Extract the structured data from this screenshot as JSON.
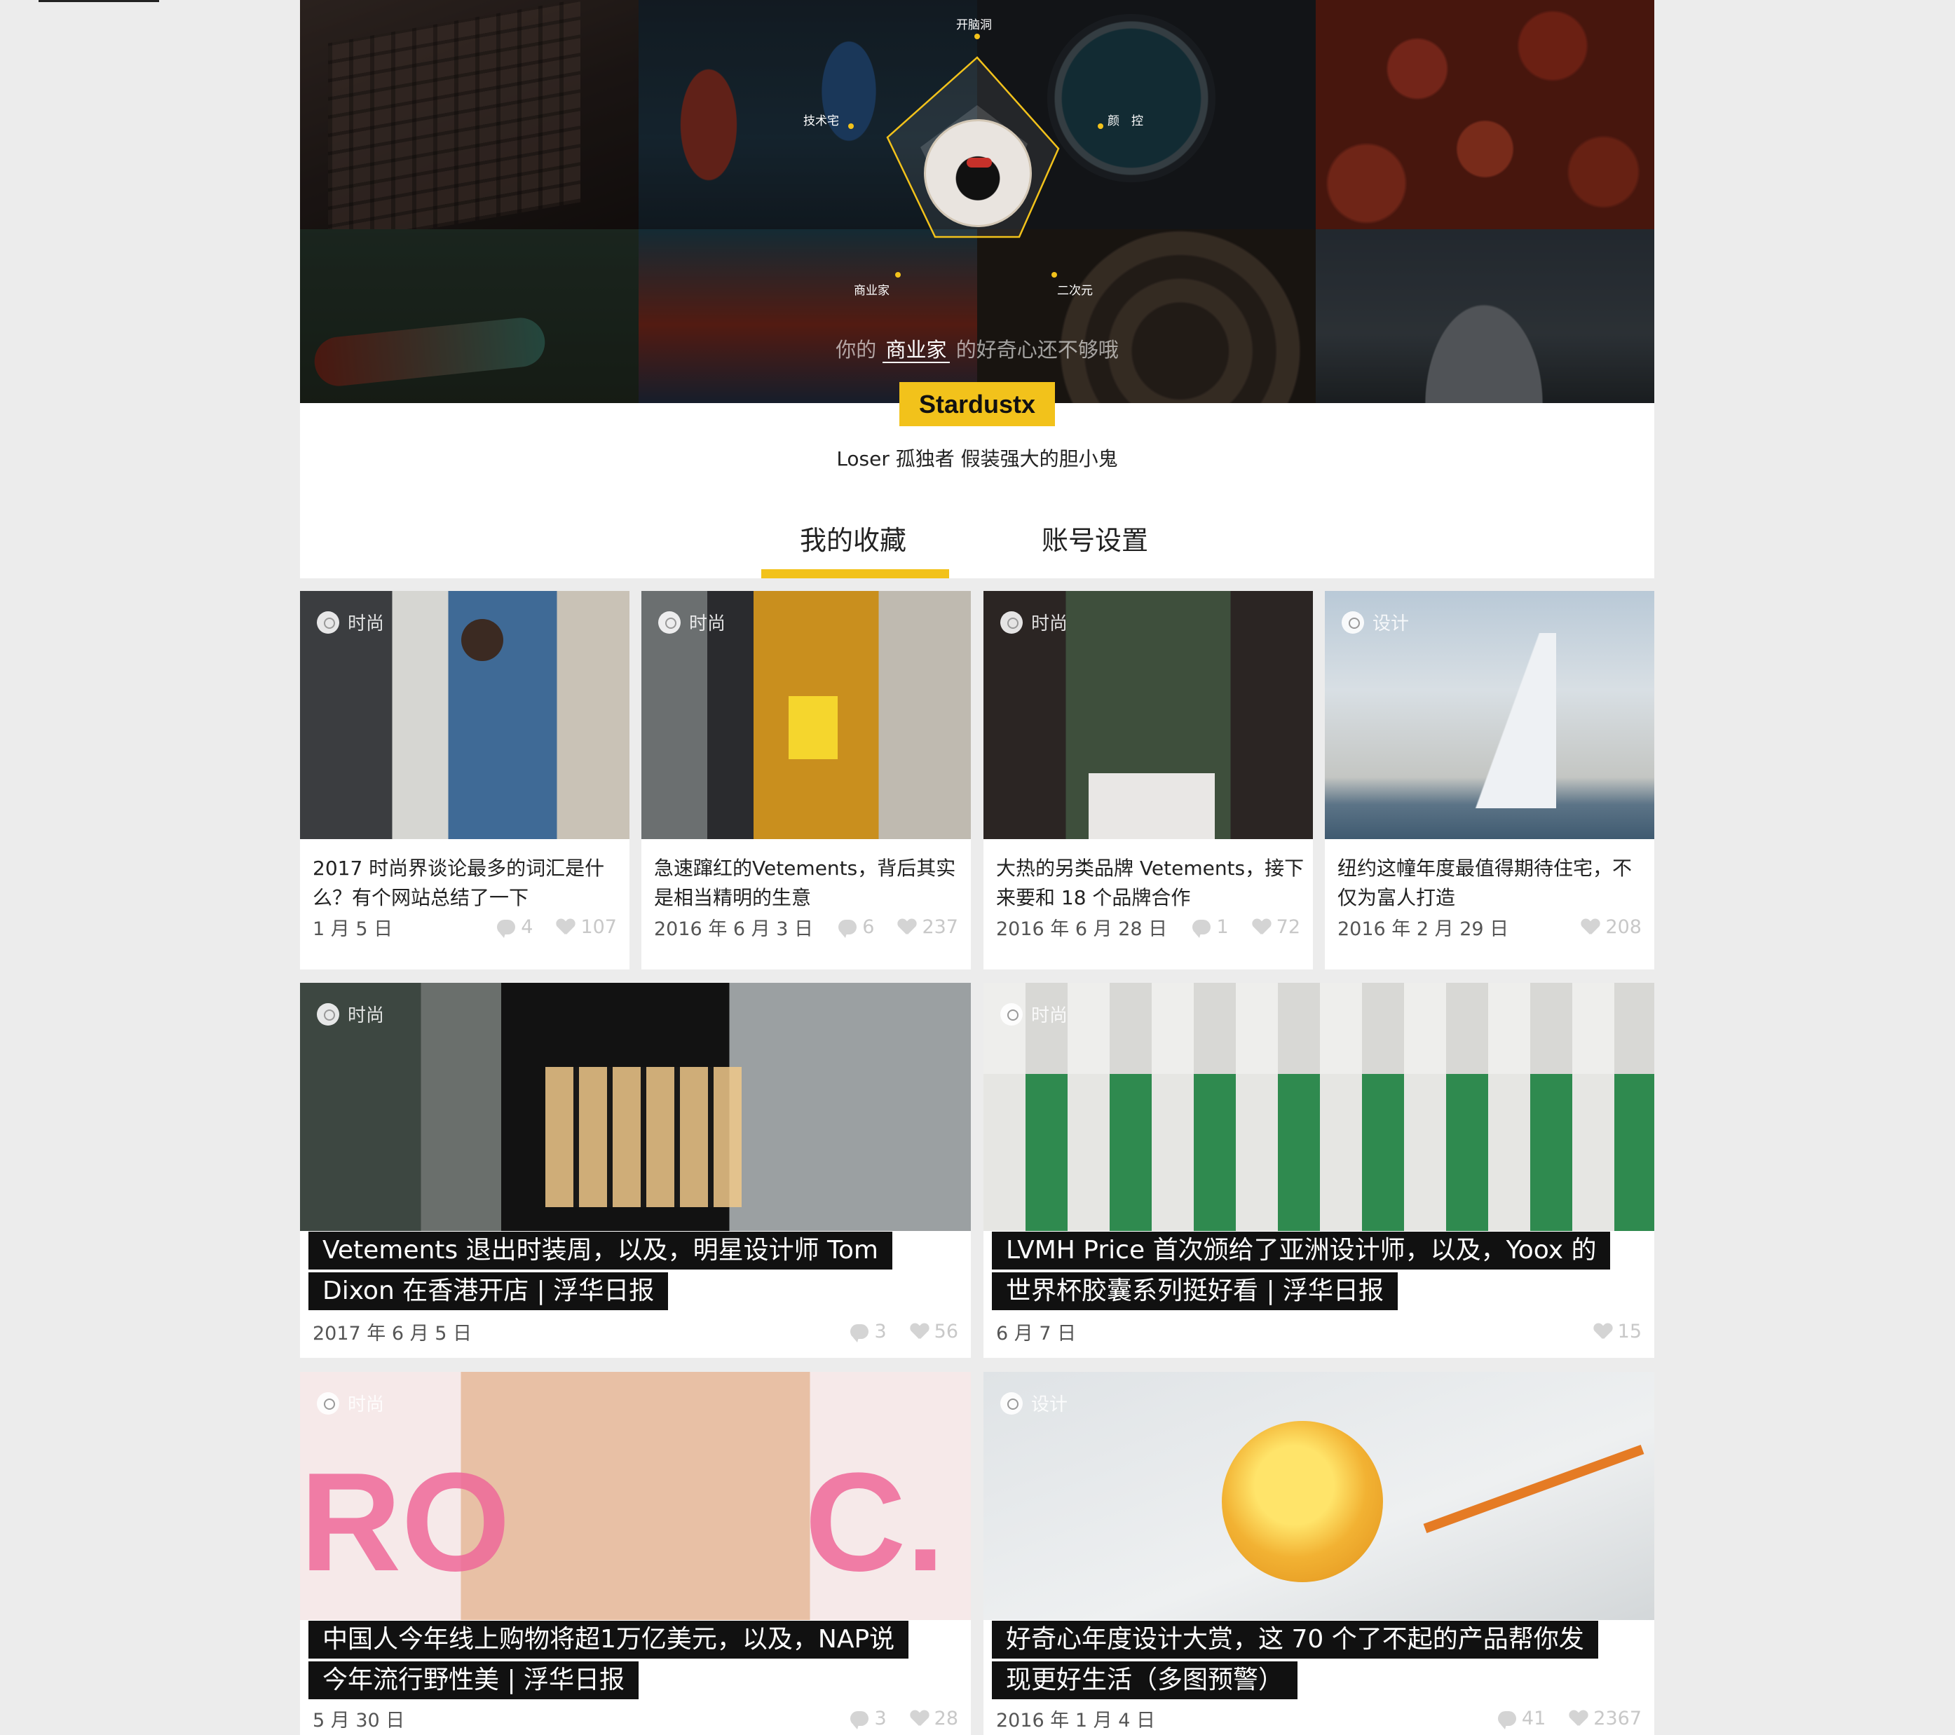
{
  "hero": {
    "radar_labels": {
      "brain": "开脑洞",
      "tech": "技术宅",
      "looks": "颜　控",
      "business": "商业家",
      "acg": "二次元"
    },
    "hint": {
      "prefix": "你的",
      "emphasis": "商业家",
      "suffix": "的好奇心还不够哦"
    },
    "accent_color": "#f2c21b"
  },
  "profile": {
    "username": "Stardustx",
    "bio": "Loser 孤独者 假装强大的胆小鬼"
  },
  "tabs": {
    "favorites": "我的收藏",
    "settings": "账号设置",
    "active": "favorites"
  },
  "cards_small": [
    {
      "category": "时尚",
      "title": "2017 时尚界谈论最多的词汇是什么？有个网站总结了一下",
      "date": "1 月 5 日",
      "comments": "4",
      "likes": "107"
    },
    {
      "category": "时尚",
      "title": "急速蹿红的Vetements，背后其实是相当精明的生意",
      "date": "2016 年 6 月 3 日",
      "comments": "6",
      "likes": "237"
    },
    {
      "category": "时尚",
      "title": "大热的另类品牌 Vetements，接下来要和 18 个品牌合作",
      "date": "2016 年 6 月 28 日",
      "comments": "1",
      "likes": "72"
    },
    {
      "category": "设计",
      "title": "纽约这幢年度最值得期待住宅，不仅为富人打造",
      "date": "2016 年 2 月 29 日",
      "likes": "208"
    }
  ],
  "cards_big": [
    {
      "category": "时尚",
      "title_line1": "Vetements 退出时装周，以及，明星设计师 Tom",
      "title_line2": "Dixon 在香港开店 | 浮华日报",
      "date": "2017 年 6 月 5 日",
      "comments": "3",
      "likes": "56"
    },
    {
      "category": "时尚",
      "title_line1": "LVMH Price 首次颁给了亚洲设计师，以及，Yoox 的",
      "title_line2": "世界杯胶囊系列挺好看 | 浮华日报",
      "date": "6 月 7 日",
      "likes": "15"
    },
    {
      "category": "时尚",
      "title_line1": "中国人今年线上购物将超1万亿美元，以及，NAP说",
      "title_line2": "今年流行野性美 | 浮华日报",
      "date": "5 月 30 日",
      "comments": "3",
      "likes": "28"
    },
    {
      "category": "设计",
      "title_line1": "好奇心年度设计大赏，这 70 个了不起的产品帮你发",
      "title_line2": "现更好生活（多图预警）",
      "date": "2016 年 1 月 4 日",
      "comments": "41",
      "likes": "2367"
    }
  ]
}
